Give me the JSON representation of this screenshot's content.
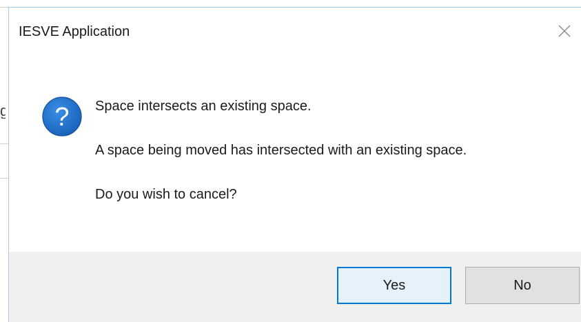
{
  "background": {
    "partial_glyph": "g"
  },
  "dialog": {
    "title": "IESVE Application",
    "close_icon": "close-icon",
    "icon": "question-icon",
    "icon_glyph": "?",
    "messages": {
      "heading": "Space intersects an existing space.",
      "detail": "A space being moved has intersected with an existing space.",
      "prompt": "Do you wish to cancel?"
    },
    "buttons": {
      "yes_label": "Yes",
      "no_label": "No"
    },
    "colors": {
      "accent": "#0078d7",
      "icon_blue": "#1e6fc9",
      "footer_bg": "#f0f0f0",
      "yes_bg": "#e5f1fb",
      "no_bg": "#e1e1e1"
    }
  }
}
